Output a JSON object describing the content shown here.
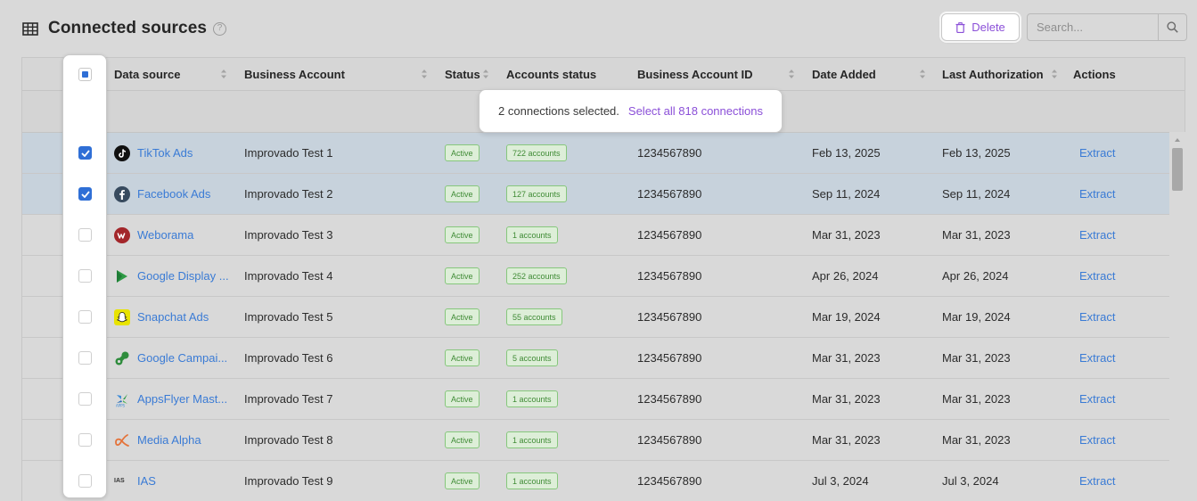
{
  "header": {
    "title": "Connected sources",
    "help_glyph": "?",
    "delete_label": "Delete",
    "search_placeholder": "Search..."
  },
  "columns": {
    "data_source": "Data source",
    "business_account": "Business Account",
    "status": "Status",
    "accounts_status": "Accounts status",
    "business_account_id": "Business Account ID",
    "date_added": "Date Added",
    "last_authorization": "Last Authorization",
    "actions": "Actions"
  },
  "selection": {
    "text": "2 connections selected.",
    "select_all": "Select all 818 connections"
  },
  "colors": {
    "accent_purple": "#8b4fd8",
    "link_blue": "#3a7bd5",
    "checkbox_blue": "#2f6fd6",
    "selected_row": "#c7d2dc",
    "status_green": "#3f8b35"
  },
  "rows": [
    {
      "icon": "tiktok-icon",
      "source": "TikTok Ads",
      "account": "Improvado Test 1",
      "status": "Active",
      "accounts": "722 accounts",
      "id": "1234567890",
      "added": "Feb 13, 2025",
      "auth": "Feb 13, 2025",
      "action": "Extract",
      "selected": true
    },
    {
      "icon": "facebook-icon",
      "source": "Facebook Ads",
      "account": "Improvado Test 2",
      "status": "Active",
      "accounts": "127 accounts",
      "id": "1234567890",
      "added": "Sep 11, 2024",
      "auth": "Sep 11, 2024",
      "action": "Extract",
      "selected": true
    },
    {
      "icon": "weborama-icon",
      "source": "Weborama",
      "account": "Improvado Test 3",
      "status": "Active",
      "accounts": "1 accounts",
      "id": "1234567890",
      "added": "Mar 31, 2023",
      "auth": "Mar 31, 2023",
      "action": "Extract",
      "selected": false
    },
    {
      "icon": "google-display-icon",
      "source": "Google Display ...",
      "account": "Improvado Test 4",
      "status": "Active",
      "accounts": "252 accounts",
      "id": "1234567890",
      "added": "Apr 26, 2024",
      "auth": "Apr 26, 2024",
      "action": "Extract",
      "selected": false
    },
    {
      "icon": "snapchat-icon",
      "source": "Snapchat Ads",
      "account": "Improvado Test 5",
      "status": "Active",
      "accounts": "55 accounts",
      "id": "1234567890",
      "added": "Mar 19, 2024",
      "auth": "Mar 19, 2024",
      "action": "Extract",
      "selected": false
    },
    {
      "icon": "google-campaign-icon",
      "source": "Google Campai...",
      "account": "Improvado Test 6",
      "status": "Active",
      "accounts": "5 accounts",
      "id": "1234567890",
      "added": "Mar 31, 2023",
      "auth": "Mar 31, 2023",
      "action": "Extract",
      "selected": false
    },
    {
      "icon": "appsflyer-icon",
      "source": "AppsFlyer Mast...",
      "account": "Improvado Test 7",
      "status": "Active",
      "accounts": "1 accounts",
      "id": "1234567890",
      "added": "Mar 31, 2023",
      "auth": "Mar 31, 2023",
      "action": "Extract",
      "selected": false
    },
    {
      "icon": "media-alpha-icon",
      "source": "Media Alpha",
      "account": "Improvado Test 8",
      "status": "Active",
      "accounts": "1 accounts",
      "id": "1234567890",
      "added": "Mar 31, 2023",
      "auth": "Mar 31, 2023",
      "action": "Extract",
      "selected": false
    },
    {
      "icon": "ias-icon",
      "icon_text": "IAS",
      "source": "IAS",
      "account": "Improvado Test 9",
      "status": "Active",
      "accounts": "1 accounts",
      "id": "1234567890",
      "added": "Jul 3, 2024",
      "auth": "Jul 3, 2024",
      "action": "Extract",
      "selected": false
    }
  ]
}
